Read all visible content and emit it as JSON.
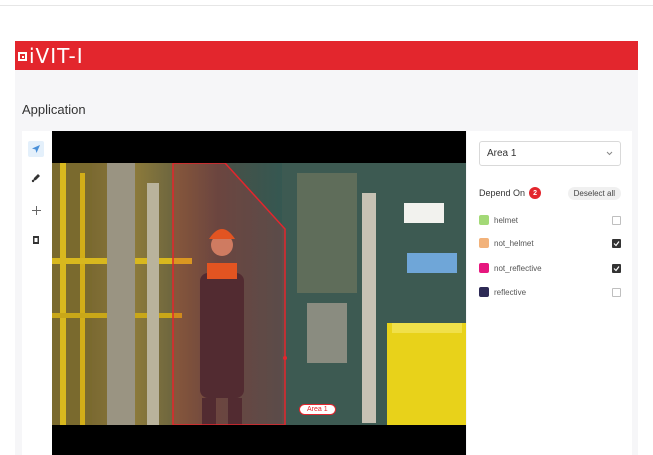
{
  "brand": {
    "name": "iVIT-I",
    "color": "#e3262d"
  },
  "page": {
    "title": "Application"
  },
  "toolbar": {
    "tools": [
      {
        "icon": "cursor-arrow-icon",
        "active": true
      },
      {
        "icon": "polygon-pen-icon",
        "active": false
      },
      {
        "icon": "crosshair-plus-icon",
        "active": false
      },
      {
        "icon": "eraser-icon",
        "active": false
      }
    ]
  },
  "canvas": {
    "area_label": "Area 1"
  },
  "panel": {
    "area_select": {
      "value": "Area 1"
    },
    "depend_on": {
      "label": "Depend On",
      "count": "2",
      "deselect_label": "Deselect all"
    },
    "classes": [
      {
        "label": "helmet",
        "color": "#a3d977",
        "checked": false
      },
      {
        "label": "not_helmet",
        "color": "#f2b27a",
        "checked": true
      },
      {
        "label": "not_reflective",
        "color": "#e6177e",
        "checked": true
      },
      {
        "label": "reflective",
        "color": "#2d2a55",
        "checked": false
      }
    ]
  }
}
